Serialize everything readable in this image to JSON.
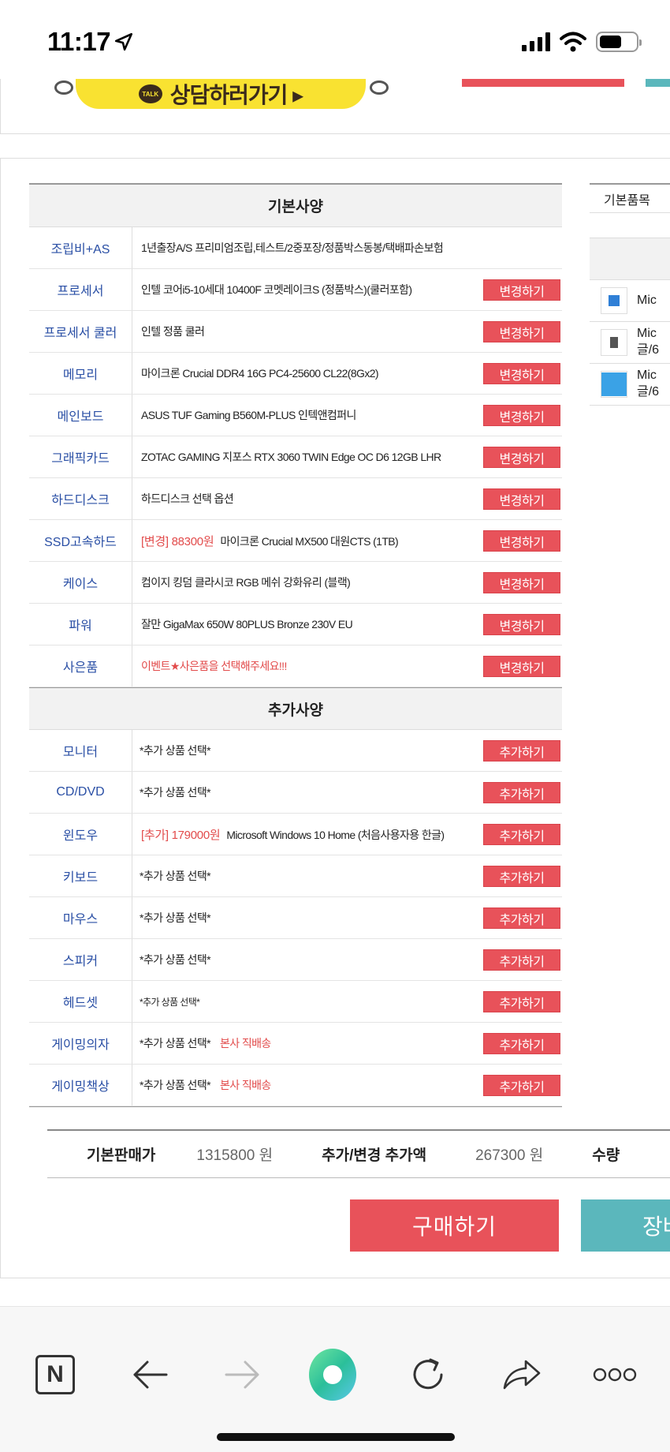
{
  "status_bar": {
    "time": "11:17"
  },
  "banner": {
    "kakao_badge": "TALK",
    "kakao_label": "상담하러가기 ▸"
  },
  "basic_spec": {
    "title": "기본사양",
    "rows": [
      {
        "label": "조립비+AS",
        "content": "1년출장A/S 프리미엄조립,테스트/2중포장/정품박스동봉/택배파손보험",
        "price": "",
        "button": ""
      },
      {
        "label": "프로세서",
        "content": "인텔 코어i5-10세대 10400F 코멧레이크S (정품박스)(쿨러포함)",
        "price": "",
        "button": "변경하기"
      },
      {
        "label": "프로세서 쿨러",
        "content": "인텔 정품 쿨러",
        "price": "",
        "button": "변경하기"
      },
      {
        "label": "메모리",
        "content": "마이크론 Crucial DDR4 16G PC4-25600 CL22(8Gx2)",
        "price": "",
        "button": "변경하기"
      },
      {
        "label": "메인보드",
        "content": "ASUS TUF Gaming B560M-PLUS 인텍앤컴퍼니",
        "price": "",
        "button": "변경하기"
      },
      {
        "label": "그래픽카드",
        "content": "ZOTAC GAMING 지포스 RTX 3060 TWIN Edge OC D6 12GB LHR",
        "price": "",
        "button": "변경하기"
      },
      {
        "label": "하드디스크",
        "content": "하드디스크 선택 옵션",
        "price": "",
        "button": "변경하기"
      },
      {
        "label": "SSD고속하드",
        "content": "마이크론 Crucial MX500 대원CTS (1TB)",
        "price": "[변경] 88300원",
        "button": "변경하기"
      },
      {
        "label": "케이스",
        "content": "컴이지 킹덤 클라시코 RGB 메쉬 강화유리 (블랙)",
        "price": "",
        "button": "변경하기"
      },
      {
        "label": "파워",
        "content": "잘만 GigaMax 650W 80PLUS Bronze 230V EU",
        "price": "",
        "button": "변경하기"
      },
      {
        "label": "사은품",
        "content": "이벤트★사은품을 선택해주세요!!!",
        "price": "",
        "button": "변경하기"
      }
    ]
  },
  "extra_spec": {
    "title": "추가사양",
    "rows": [
      {
        "label": "모니터",
        "content": "*추가 상품 선택*",
        "price": "",
        "note": "",
        "button": "추가하기"
      },
      {
        "label": "CD/DVD",
        "content": "*추가 상품 선택*",
        "price": "",
        "note": "",
        "button": "추가하기"
      },
      {
        "label": "윈도우",
        "content": "Microsoft Windows 10 Home (처음사용자용 한글)",
        "price": "[추가] 179000원",
        "note": "",
        "button": "추가하기"
      },
      {
        "label": "키보드",
        "content": "*추가 상품 선택*",
        "price": "",
        "note": "",
        "button": "추가하기"
      },
      {
        "label": "마우스",
        "content": "*추가 상품 선택*",
        "price": "",
        "note": "",
        "button": "추가하기"
      },
      {
        "label": "스피커",
        "content": "*추가 상품 선택*",
        "price": "",
        "note": "",
        "button": "추가하기"
      },
      {
        "label": "헤드셋",
        "content": "*추가 상품 선택*",
        "price": "",
        "note": "",
        "button": "추가하기"
      },
      {
        "label": "게이밍의자",
        "content": "*추가 상품 선택*",
        "price": "",
        "note": "본사 직배송",
        "button": "추가하기"
      },
      {
        "label": "게이밍책상",
        "content": "*추가 상품 선택*",
        "price": "",
        "note": "본사 직배송",
        "button": "추가하기"
      }
    ]
  },
  "right_panel": {
    "header": "기본품목",
    "items": [
      {
        "line1": "Mic",
        "line2": ""
      },
      {
        "line1": "Mic",
        "line2": "글/6"
      },
      {
        "line1": "Mic",
        "line2": "글/6"
      }
    ]
  },
  "summary": {
    "base_label": "기본판매가",
    "base_value": "1315800",
    "base_unit": "원",
    "extra_label": "추가/변경 추가액",
    "extra_value": "267300",
    "extra_unit": "원",
    "qty_label": "수량"
  },
  "actions": {
    "buy": "구매하기",
    "cart": "장바"
  },
  "browser_bar": {
    "naver": "N"
  },
  "colors": {
    "accent_red": "#e8525a",
    "label_blue": "#2a4fa5",
    "teal": "#5bb7bc",
    "kakao_yellow": "#f9e231"
  }
}
